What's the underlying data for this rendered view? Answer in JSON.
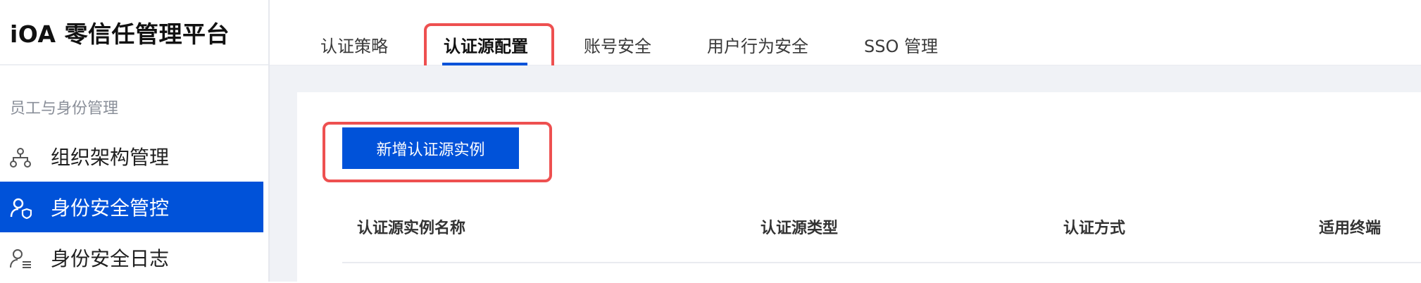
{
  "app": {
    "title": "iOA 零信任管理平台"
  },
  "sidebar": {
    "section_label": "员工与身份管理",
    "items": [
      {
        "label": "组织架构管理",
        "icon": "org-structure-icon",
        "active": false
      },
      {
        "label": "身份安全管控",
        "icon": "identity-security-icon",
        "active": true
      },
      {
        "label": "身份安全日志",
        "icon": "identity-log-icon",
        "active": false
      }
    ]
  },
  "tabs": [
    {
      "label": "认证策略",
      "active": false
    },
    {
      "label": "认证源配置",
      "active": true
    },
    {
      "label": "账号安全",
      "active": false
    },
    {
      "label": "用户行为安全",
      "active": false
    },
    {
      "label": "SSO 管理",
      "active": false
    }
  ],
  "main": {
    "add_button_label": "新增认证源实例",
    "table": {
      "columns": [
        "认证源实例名称",
        "认证源类型",
        "认证方式",
        "适用终端"
      ]
    }
  },
  "colors": {
    "accent": "#0052d9",
    "highlight": "#ee5050",
    "content_background": "#f0f2f6"
  }
}
